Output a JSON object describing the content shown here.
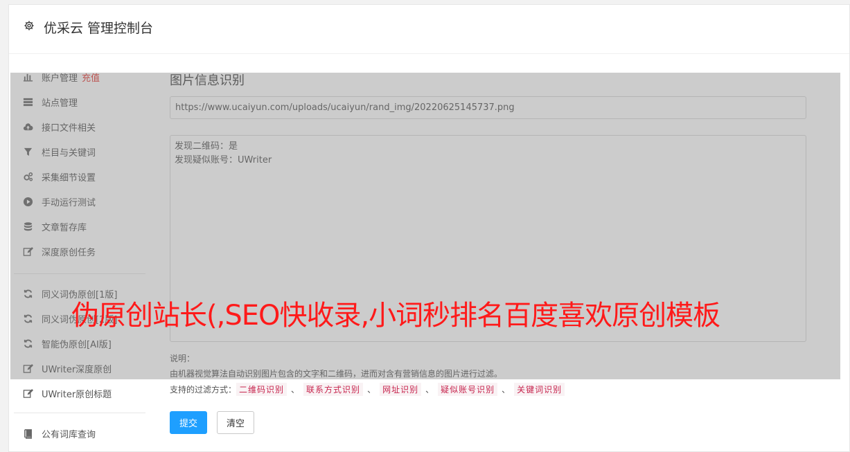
{
  "header": {
    "title": "优采云 管理控制台",
    "icon": "gear-icon"
  },
  "sidebar": {
    "items": [
      {
        "label": "账户管理",
        "extra": "充值",
        "icon": "bar-chart-icon"
      },
      {
        "label": "站点管理",
        "icon": "server-icon"
      },
      {
        "label": "接口文件相关",
        "icon": "cloud-upload-icon"
      },
      {
        "label": "栏目与关键词",
        "icon": "filter-icon"
      },
      {
        "label": "采集细节设置",
        "icon": "gears-icon"
      },
      {
        "label": "手动运行测试",
        "icon": "play-circle-icon"
      },
      {
        "label": "文章暂存库",
        "icon": "database-icon"
      },
      {
        "label": "深度原创任务",
        "icon": "edit-icon"
      },
      {
        "label": "同义词伪原创[1版]",
        "icon": "refresh-icon"
      },
      {
        "label": "同义词伪原创[2版]",
        "icon": "refresh-icon"
      },
      {
        "label": "智能伪原创[AI版]",
        "icon": "refresh-icon"
      },
      {
        "label": "UWriter深度原创",
        "icon": "edit-icon"
      },
      {
        "label": "UWriter原创标题",
        "icon": "edit-icon"
      },
      {
        "label": "公有词库查询",
        "icon": "book-icon"
      }
    ]
  },
  "main": {
    "title": "图片信息识别",
    "url_value": "https://www.ucaiyun.com/uploads/ucaiyun/rand_img/20220625145737.png",
    "result_lines": [
      "发现二维码：是",
      "发现疑似账号：UWriter"
    ],
    "note_label": "说明：",
    "note_text": "由机器视觉算法自动识别图片包含的文字和二维码，进而对含有营销信息的图片进行过滤。",
    "filters_label": "支持的过滤方式：",
    "filters": [
      "二维码识别",
      "联系方式识别",
      "网址识别",
      "疑似账号识别",
      "关键词识别"
    ],
    "filter_sep": "、",
    "submit_label": "提交",
    "clear_label": "清空"
  },
  "watermark": "伪原创站长(,SEO快收录,小词秒排名百度喜欢原创模板",
  "colors": {
    "accent": "#1e9fff",
    "recharge": "#e53935",
    "watermark": "#ff1a1a",
    "tag": "#c7254e",
    "overlay": "rgba(128,128,128,0.4)"
  }
}
